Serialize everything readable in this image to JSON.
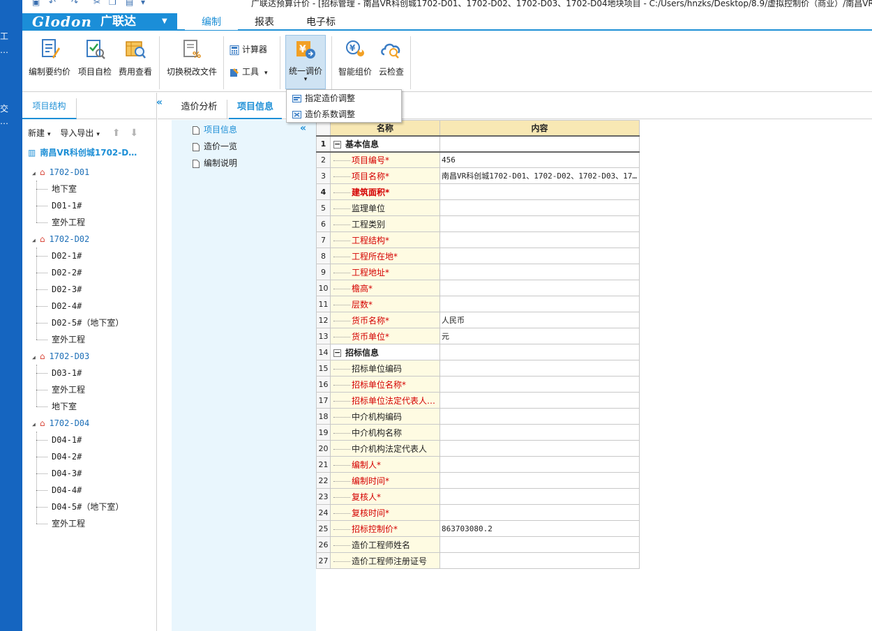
{
  "desktop": {
    "fragments": [
      "工",
      "…",
      "交",
      "…"
    ]
  },
  "titlebar": {
    "text": "广联达预算计价 - [招标管理 - 南昌VR科创城1702-D01、1702-D02、1702-D03、1702-D04地块项目 - C:/Users/hnzks/Desktop/8.9/虚拟控制价（商业）/南昌VR科"
  },
  "menu": {
    "brand": "Glodon",
    "brand_cn": "广联达",
    "brand_dropdown": "▼",
    "tabs": [
      "编制",
      "报表",
      "电子标"
    ],
    "active_tab": "编制"
  },
  "ribbon": {
    "buttons": [
      {
        "label": "编制要约价",
        "icon": "edit-doc-icon"
      },
      {
        "label": "项目自检",
        "icon": "check-doc-icon"
      },
      {
        "label": "费用查看",
        "icon": "cost-view-icon"
      },
      {
        "label": "切换税改文件",
        "icon": "tax-switch-icon"
      }
    ],
    "calculator_label": "计算器",
    "tools_label": "工具",
    "unified_adjust_label": "统一调价",
    "smart_price_label": "智能组价",
    "cloud_check_label": "云检查"
  },
  "popup": {
    "items": [
      "指定造价调整",
      "造价系数调整"
    ]
  },
  "left_panel": {
    "tab": "项目结构",
    "tools": {
      "new": "新建",
      "import_export": "导入导出"
    },
    "project": "南昌VR科创城1702-D…",
    "units": [
      {
        "name": "1702-D01",
        "children": [
          "地下室",
          "D01-1#",
          "室外工程"
        ]
      },
      {
        "name": "1702-D02",
        "children": [
          "D02-1#",
          "D02-2#",
          "D02-3#",
          "D02-4#",
          "D02-5#（地下室）",
          "室外工程"
        ]
      },
      {
        "name": "1702-D03",
        "children": [
          "D03-1#",
          "室外工程",
          "地下室"
        ]
      },
      {
        "name": "1702-D04",
        "children": [
          "D04-1#",
          "D04-2#",
          "D04-3#",
          "D04-4#",
          "D04-5#（地下室）",
          "室外工程"
        ]
      }
    ]
  },
  "content_tabs": [
    "造价分析",
    "项目信息"
  ],
  "nav_items": [
    "项目信息",
    "造价一览",
    "编制说明"
  ],
  "grid": {
    "headers": [
      "名称",
      "内容"
    ],
    "rows": [
      {
        "n": "1",
        "name": "基本信息",
        "value": "",
        "type": "group"
      },
      {
        "n": "2",
        "name": "项目编号*",
        "value": "456",
        "type": "req"
      },
      {
        "n": "3",
        "name": "项目名称*",
        "value": "南昌VR科创城1702-D01、1702-D02、1702-D03、17…",
        "type": "req"
      },
      {
        "n": "4",
        "name": "建筑面积*",
        "value": "",
        "type": "boldreq"
      },
      {
        "n": "5",
        "name": "监理单位",
        "value": "",
        "type": "normal"
      },
      {
        "n": "6",
        "name": "工程类别",
        "value": "",
        "type": "normal"
      },
      {
        "n": "7",
        "name": "工程结构*",
        "value": "",
        "type": "req"
      },
      {
        "n": "8",
        "name": "工程所在地*",
        "value": "",
        "type": "req"
      },
      {
        "n": "9",
        "name": "工程地址*",
        "value": "",
        "type": "req"
      },
      {
        "n": "10",
        "name": "檐高*",
        "value": "",
        "type": "req"
      },
      {
        "n": "11",
        "name": "层数*",
        "value": "",
        "type": "req"
      },
      {
        "n": "12",
        "name": "货币名称*",
        "value": "人民币",
        "type": "req"
      },
      {
        "n": "13",
        "name": "货币单位*",
        "value": "元",
        "type": "req"
      },
      {
        "n": "14",
        "name": "招标信息",
        "value": "",
        "type": "group"
      },
      {
        "n": "15",
        "name": "招标单位编码",
        "value": "",
        "type": "normal"
      },
      {
        "n": "16",
        "name": "招标单位名称*",
        "value": "",
        "type": "req"
      },
      {
        "n": "17",
        "name": "招标单位法定代表人…",
        "value": "",
        "type": "req"
      },
      {
        "n": "18",
        "name": "中介机构编码",
        "value": "",
        "type": "normal"
      },
      {
        "n": "19",
        "name": "中介机构名称",
        "value": "",
        "type": "normal"
      },
      {
        "n": "20",
        "name": "中介机构法定代表人",
        "value": "",
        "type": "normal"
      },
      {
        "n": "21",
        "name": "编制人*",
        "value": "",
        "type": "req"
      },
      {
        "n": "22",
        "name": "编制时间*",
        "value": "",
        "type": "req"
      },
      {
        "n": "23",
        "name": "复核人*",
        "value": "",
        "type": "req"
      },
      {
        "n": "24",
        "name": "复核时间*",
        "value": "",
        "type": "req"
      },
      {
        "n": "25",
        "name": "招标控制价*",
        "value": "863703080.2",
        "type": "req"
      },
      {
        "n": "26",
        "name": "造价工程师姓名",
        "value": "",
        "type": "normal"
      },
      {
        "n": "27",
        "name": "造价工程师注册证号",
        "value": "",
        "type": "normal"
      }
    ]
  },
  "colors": {
    "accent": "#1d8fd6",
    "required": "#d40000",
    "header_bg": "#f8e8b4",
    "name_bg": "#fefbe2",
    "nav_bg": "#e9f6fd"
  }
}
